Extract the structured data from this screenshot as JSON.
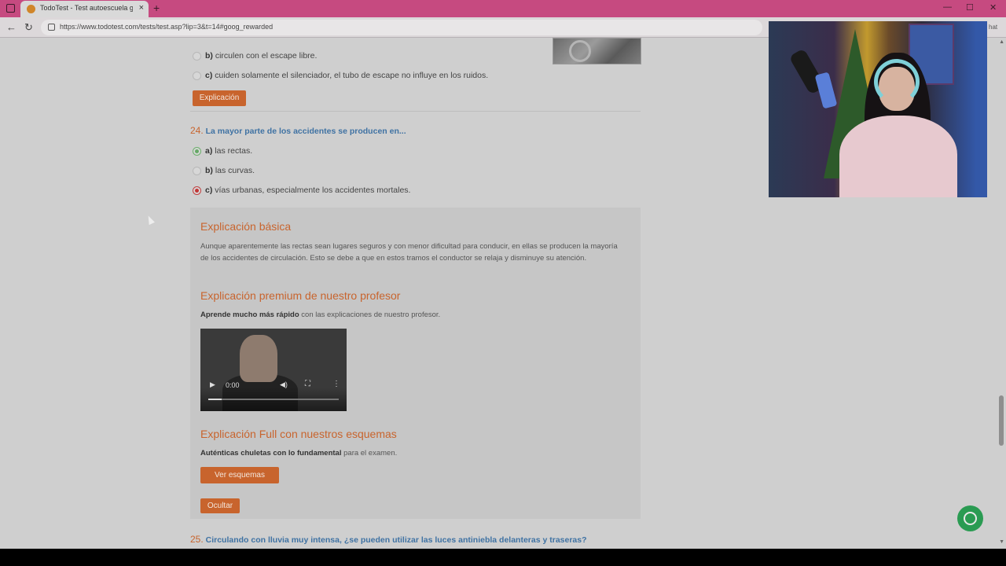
{
  "browser": {
    "tab_title": "TodoTest - Test autoescuela grati",
    "tab_close": "×",
    "new_tab": "+",
    "url": "https://www.todotest.com/tests/test.asp?lip=3&t=14#goog_rewarded",
    "back": "←",
    "reload": "↻",
    "minimize": "—",
    "maximize": "☐",
    "close": "✕",
    "chat_label": "hat"
  },
  "q23": {
    "option_b_letter": "b)",
    "option_b_text": "circulen con el escape libre.",
    "option_c_letter": "c)",
    "option_c_text": "cuiden solamente el silenciador, el tubo de escape no influye en los ruidos.",
    "explain_button": "Explicación"
  },
  "q24": {
    "number": "24.",
    "text": "La mayor parte de los accidentes se producen en...",
    "options": [
      {
        "letter": "a)",
        "text": "las rectas.",
        "state": "correct"
      },
      {
        "letter": "b)",
        "text": "las curvas.",
        "state": "none"
      },
      {
        "letter": "c)",
        "text": "vías urbanas, especialmente los accidentes mortales.",
        "state": "wrong"
      }
    ]
  },
  "explanation": {
    "basic_title": "Explicación básica",
    "basic_text": "Aunque aparentemente las rectas sean lugares seguros y con menor dificultad para conducir, en ellas se producen la mayoría de los accidentes de circulación. Esto se debe a que en estos tramos el conductor se relaja y disminuye su atención.",
    "premium_title": "Explicación premium de nuestro profesor",
    "premium_bold": "Aprende mucho más rápido",
    "premium_rest": " con las explicaciones de nuestro profesor.",
    "video_time": "0:00",
    "video_progress": 0.1,
    "full_title": "Explicación Full con nuestros esquemas",
    "full_bold": "Auténticas chuletas con lo fundamental",
    "full_rest": " para el examen.",
    "schemes_button": "Ver esquemas",
    "hide_button": "Ocultar"
  },
  "q25": {
    "number": "25.",
    "text": "Circulando con lluvia muy intensa, ¿se pueden utilizar las luces antiniebla delanteras y traseras?"
  },
  "icons": {
    "window": "window-icon",
    "favicon": "todotest-favicon-icon",
    "lock": "lock-icon",
    "whatsapp": "whatsapp-icon",
    "cursor": "mouse-cursor-icon"
  },
  "colors": {
    "accent_orange": "#c8642d",
    "question_blue": "#3f72a3",
    "tab_bar": "#c64a80",
    "correct_green": "#66a866",
    "wrong_red": "#c23535"
  }
}
